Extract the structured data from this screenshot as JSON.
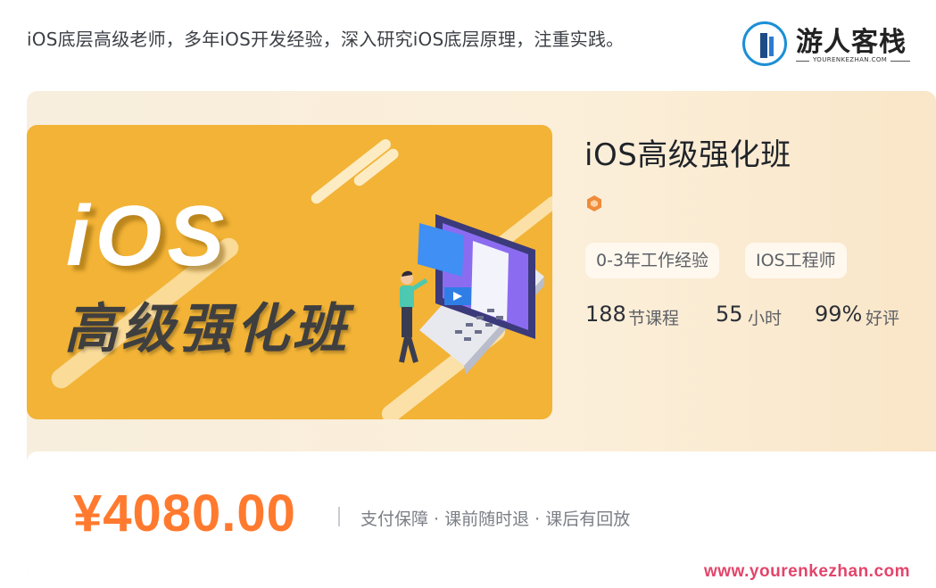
{
  "intro_text": "iOS底层高级老师，多年iOS开发经验，深入研究iOS底层原理，注重实践。",
  "brand": {
    "name": "游人客栈",
    "url": "YOURENKEZHAN.COM",
    "icon": "bookmark-logo-icon"
  },
  "cover": {
    "big_text": "iOS",
    "title": "高级强化班",
    "background_color": "#f2b336",
    "illustration": "laptop-presenter-illustration"
  },
  "course": {
    "title": "iOS高级强化班",
    "badge_icon": "hexagon-badge-icon",
    "tags": [
      "0-3年工作经验",
      "IOS工程师"
    ],
    "stats": [
      {
        "value": "188",
        "unit": "节课程"
      },
      {
        "value": "55",
        "unit": "小时"
      },
      {
        "value": "99%",
        "unit": "好评"
      }
    ]
  },
  "pricing": {
    "price": "¥4080.00",
    "price_color": "#ff7a2e",
    "guarantee": "支付保障 · 课前随时退 · 课后有回放"
  },
  "watermark": "www.yourenkezhan.com",
  "colors": {
    "accent": "#ff7a2e",
    "brand_blue": "#1b8fd6",
    "watermark": "#e2456b"
  }
}
